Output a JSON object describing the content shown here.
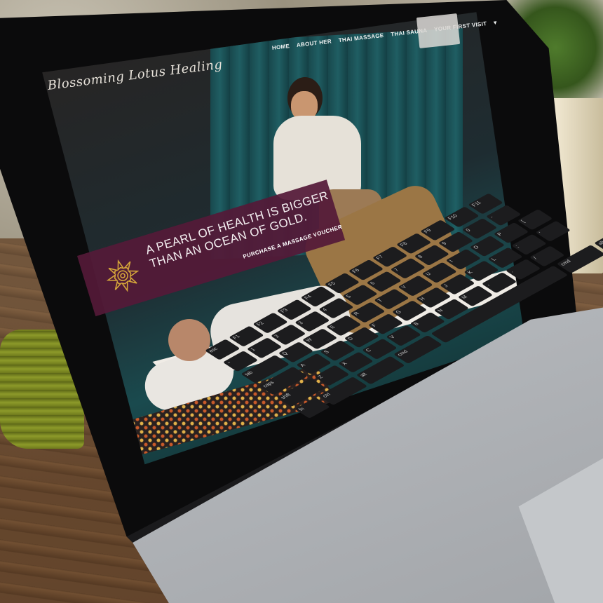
{
  "site": {
    "logo_text": "Blossoming Lotus Healing",
    "nav": [
      {
        "label": "HOME"
      },
      {
        "label": "ABOUT HER"
      },
      {
        "label": "THAI MASSAGE"
      },
      {
        "label": "THAI SAUNA"
      },
      {
        "label": "YOUR FIRST VISIT"
      }
    ],
    "dropdown_indicator": "▾",
    "hero": {
      "headline_line1": "A PEARL OF HEALTH IS BIGGER",
      "headline_line2": "THAN AN OCEAN OF GOLD.",
      "cta_label": "PURCHASE A MASSAGE VOUCHER",
      "banner_color": "#541a38",
      "accent_color": "#d4a53a"
    }
  },
  "keyboard": {
    "rows": [
      [
        "esc",
        "F1",
        "F2",
        "F3",
        "F4",
        "F5",
        "F6",
        "F7",
        "F8",
        "F9",
        "F10",
        "F11"
      ],
      [
        "~",
        "1",
        "2",
        "3",
        "4",
        "5",
        "6",
        "7",
        "8",
        "9",
        "0",
        "-"
      ],
      [
        "tab",
        "Q",
        "W",
        "E",
        "R",
        "T",
        "Y",
        "U",
        "I",
        "O",
        "P",
        "["
      ],
      [
        "caps",
        "A",
        "S",
        "D",
        "F",
        "G",
        "H",
        "J",
        "K",
        "L",
        ";",
        "'"
      ],
      [
        "shift",
        "Z",
        "X",
        "C",
        "V",
        "B",
        "N",
        "M",
        ",",
        ".",
        "/"
      ],
      [
        "fn",
        "ctrl",
        "alt",
        "cmd",
        "",
        "cmd",
        "alt"
      ]
    ]
  }
}
